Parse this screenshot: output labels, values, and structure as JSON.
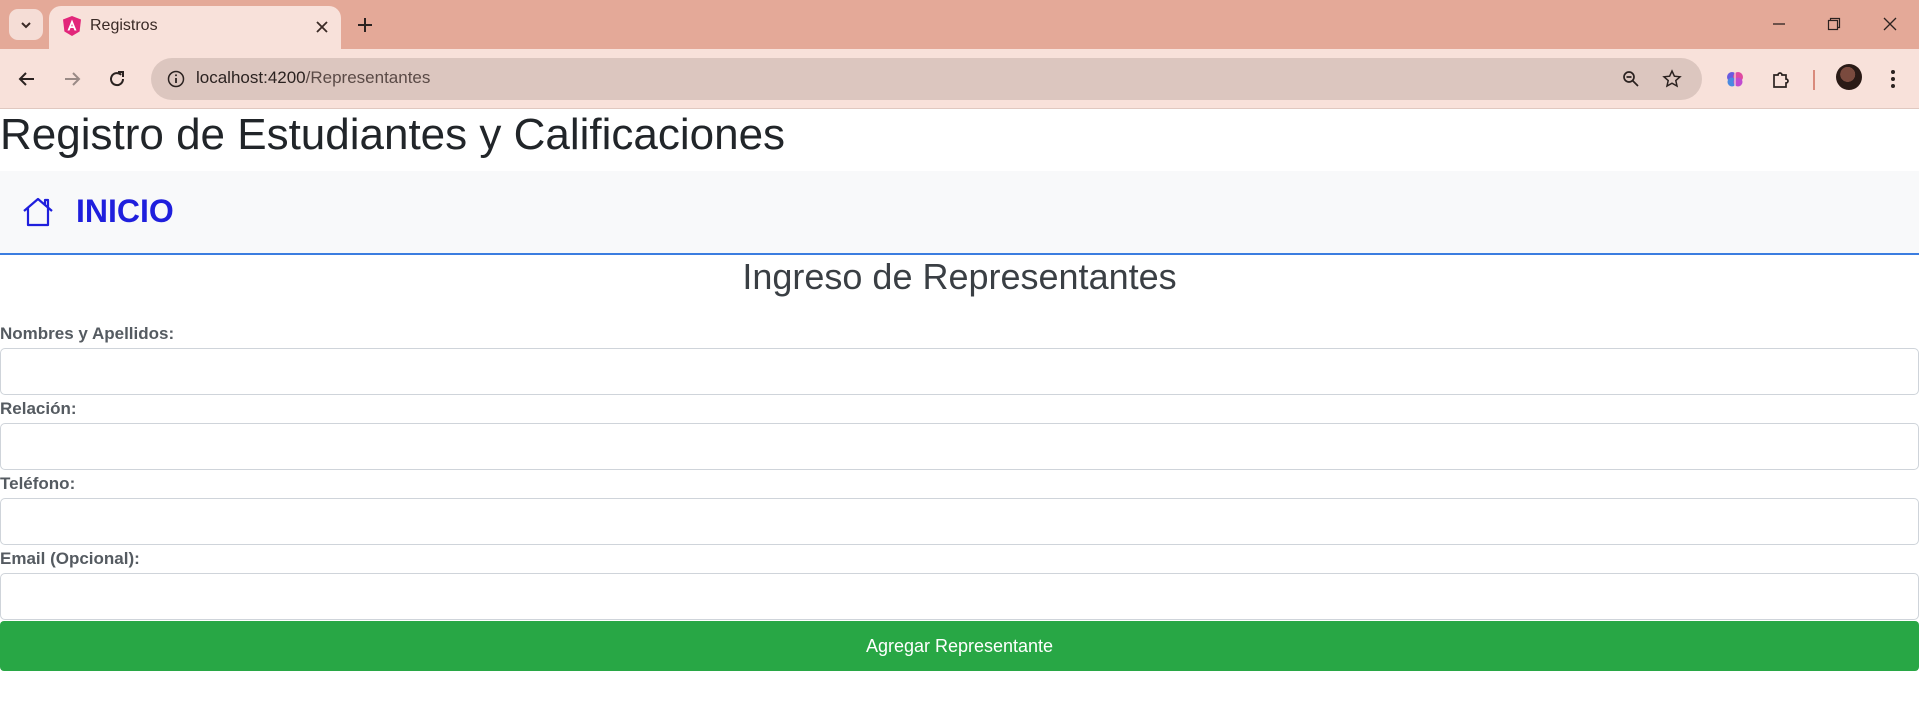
{
  "browser": {
    "tab_title": "Registros",
    "url_host": "localhost:4200",
    "url_path": "/Representantes"
  },
  "page": {
    "title": "Registro de Estudiantes y Calificaciones",
    "nav": {
      "home_label": "INICIO"
    },
    "section_title": "Ingreso de Representantes"
  },
  "form": {
    "fields": [
      {
        "label": "Nombres y Apellidos:",
        "value": ""
      },
      {
        "label": "Relación:",
        "value": ""
      },
      {
        "label": "Teléfono:",
        "value": ""
      },
      {
        "label": "Email (Opcional):",
        "value": ""
      }
    ],
    "submit_label": "Agregar Representante"
  },
  "colors": {
    "titlebar": "#e4a998",
    "toolbar": "#f8e1da",
    "nav_link": "#1f1fdd",
    "nav_border": "#3b7de0",
    "submit_button": "#28a745"
  },
  "icons": [
    "tab-list-chevron-icon",
    "angular-logo-icon",
    "close-icon",
    "plus-icon",
    "minimize-icon",
    "restore-icon",
    "close-window-icon",
    "back-arrow-icon",
    "forward-arrow-icon",
    "reload-icon",
    "site-info-icon",
    "zoom-icon",
    "star-icon",
    "extension-brain-icon",
    "puzzle-icon",
    "kebab-menu-icon",
    "home-icon"
  ]
}
